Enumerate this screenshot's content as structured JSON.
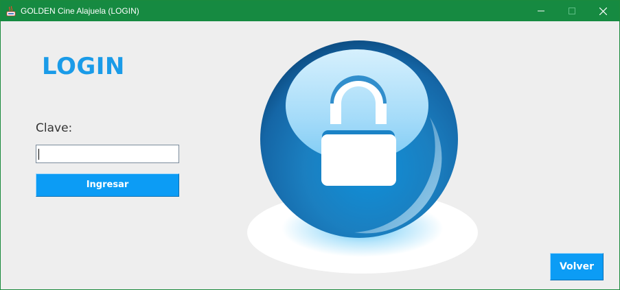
{
  "window": {
    "title": "GOLDEN Cine Alajuela (LOGIN)",
    "titlebar_color": "#168a41",
    "controls": [
      "minimize-icon",
      "maximize-icon",
      "close-icon"
    ]
  },
  "login": {
    "heading": "LOGIN",
    "password_label": "Clave:",
    "password_value": "",
    "submit_label": "Ingresar"
  },
  "illustration": {
    "icon": "padlock-sphere-icon"
  },
  "footer": {
    "back_label": "Volver"
  },
  "colors": {
    "accent": "#0c9cf5",
    "heading": "#1a9be8",
    "background": "#eeeeee"
  }
}
